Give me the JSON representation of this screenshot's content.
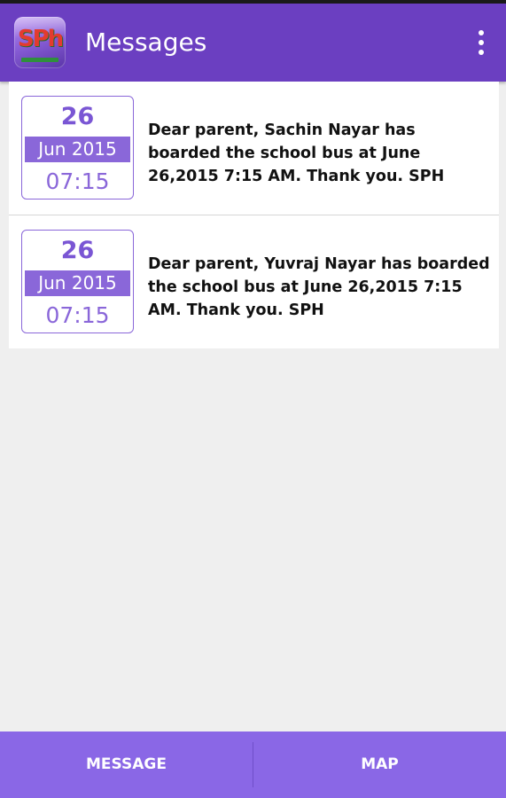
{
  "app_bar": {
    "logo_text": "SPh",
    "title": "Messages",
    "overflow_icon": "more-vert-icon"
  },
  "messages": [
    {
      "day": "26",
      "month_year": "Jun 2015",
      "time": "07:15",
      "text": "Dear parent, Sachin Nayar has boarded the school bus at June 26,2015 7:15 AM. Thank you. SPH"
    },
    {
      "day": "26",
      "month_year": "Jun 2015",
      "time": "07:15",
      "text": "Dear parent, Yuvraj Nayar has boarded the school bus at June 26,2015 7:15 AM. Thank you. SPH"
    }
  ],
  "bottom_tabs": [
    {
      "label": "MESSAGE"
    },
    {
      "label": "MAP"
    }
  ],
  "colors": {
    "app_bar": "#6b3fc1",
    "accent": "#8a67d9",
    "bottom_bar": "#8a67e6",
    "background": "#efefef"
  }
}
